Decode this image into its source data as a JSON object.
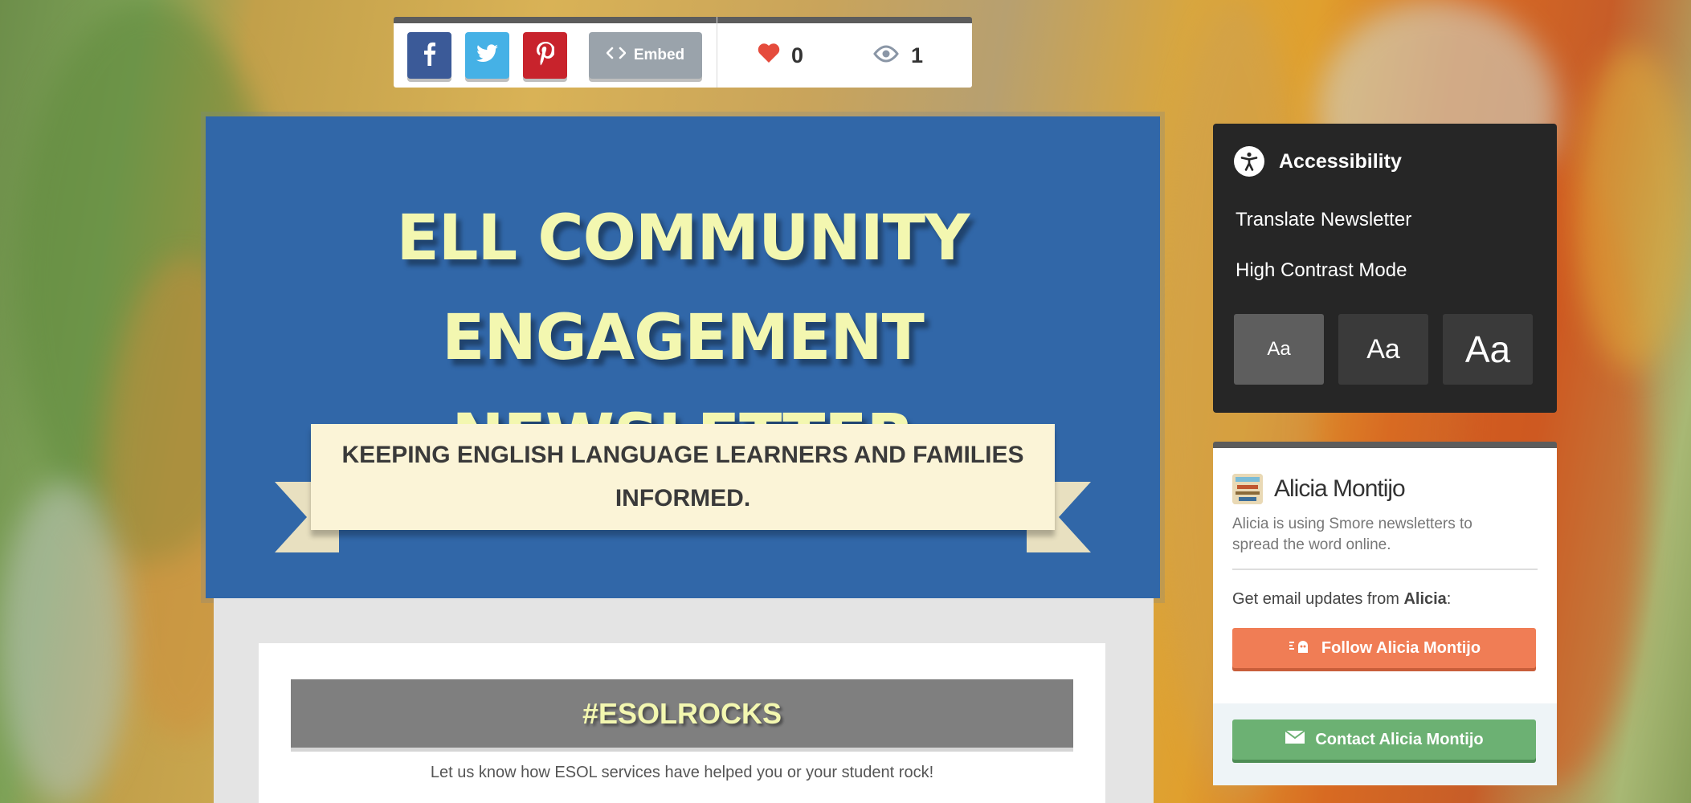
{
  "sharebar": {
    "buttons": [
      {
        "name": "facebook",
        "icon": "facebook-icon",
        "color": "#3b5a98"
      },
      {
        "name": "twitter",
        "icon": "twitter-icon",
        "color": "#45b1e6"
      },
      {
        "name": "pinterest",
        "icon": "pinterest-icon",
        "color": "#c8232c"
      }
    ],
    "embed_label": "Embed",
    "likes_count": "0",
    "views_count": "1"
  },
  "header": {
    "title_line1": "ELL COMMUNITY",
    "title_line2": "ENGAGEMENT NEWSLETTER",
    "subtitle": "KEEPING ENGLISH LANGUAGE LEARNERS AND FAMILIES INFORMED."
  },
  "content": {
    "hashtag": "#ESOLROCKS",
    "text": "Let us know how ESOL services have helped you or your student rock!"
  },
  "accessibility": {
    "title": "Accessibility",
    "translate_label": "Translate Newsletter",
    "contrast_label": "High Contrast Mode",
    "font_sizes": [
      "Aa",
      "Aa",
      "Aa"
    ]
  },
  "profile": {
    "name": "Alicia Montijo",
    "description": "Alicia is using Smore newsletters to spread the word online.",
    "updates_prefix": "Get email updates from ",
    "updates_name": "Alicia",
    "updates_suffix": ":",
    "follow_label": "Follow Alicia Montijo",
    "contact_label": "Contact Alicia Montijo"
  },
  "colors": {
    "header_blue": "#3167a8",
    "title_yellow": "#f3f7b0",
    "follow_orange": "#f07d55",
    "contact_green": "#6cb173",
    "panel_dark": "#262626"
  }
}
